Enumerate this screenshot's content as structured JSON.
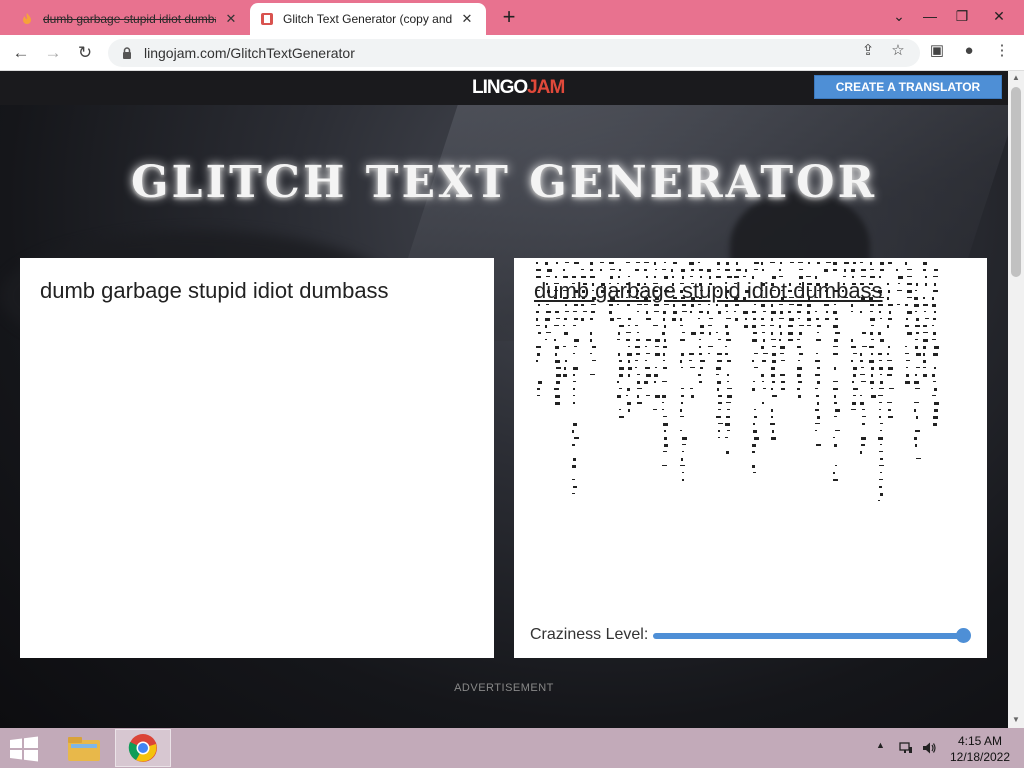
{
  "browser": {
    "tabs": [
      {
        "title": "dumb garbage stupid idiot dumbass",
        "active": false
      },
      {
        "title": "Glitch Text Generator (copy and paste)",
        "active": true
      }
    ],
    "new_tab": "+",
    "url": "lingojam.com/GlitchTextGenerator"
  },
  "site": {
    "logo_part1": "LINGO",
    "logo_part2": "JAM",
    "create_button": "CREATE A TRANSLATOR",
    "heading": "GLITCH TEXT GENERATOR"
  },
  "translator": {
    "input_text": "dumb garbage stupid idiot dumbass",
    "output_text": "dumb garbage stupid idiot dumbass",
    "craziness_label": "Craziness Level:",
    "craziness_value": 1.0
  },
  "advertisement_label": "ADVERTISEMENT",
  "taskbar": {
    "time": "4:15 AM",
    "date": "12/18/2022"
  },
  "colors": {
    "tab_strip": "#e8728f",
    "accent_blue": "#4e8fd6",
    "logo_red": "#e0493a",
    "taskbar": "#c2aab9"
  }
}
